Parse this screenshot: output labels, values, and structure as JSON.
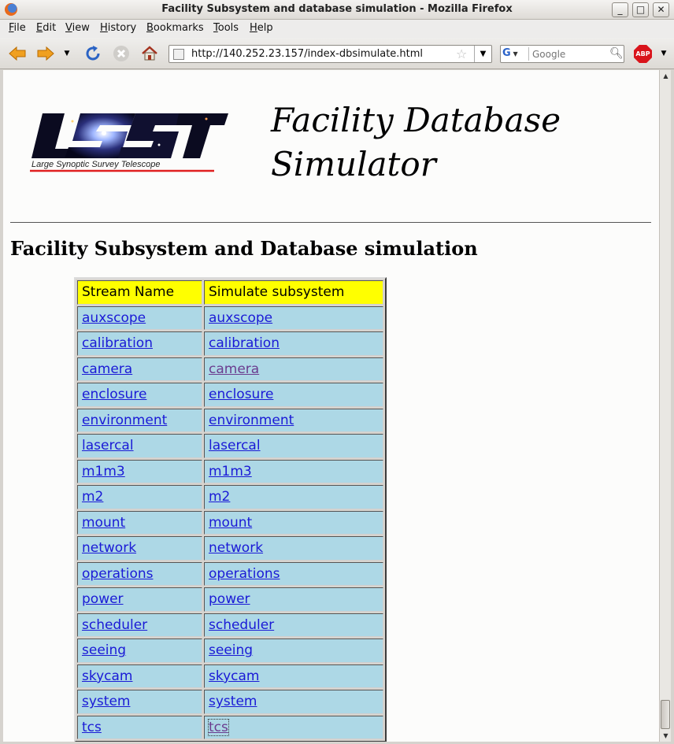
{
  "window": {
    "title": "Facility Subsystem and database simulation - Mozilla Firefox",
    "buttons": {
      "minimize": "_",
      "maximize": "□",
      "close": "✕"
    }
  },
  "menu": [
    {
      "label": "File"
    },
    {
      "label": "Edit"
    },
    {
      "label": "View"
    },
    {
      "label": "History"
    },
    {
      "label": "Bookmarks"
    },
    {
      "label": "Tools"
    },
    {
      "label": "Help"
    }
  ],
  "toolbar": {
    "url": "http://140.252.23.157/index-dbsimulate.html",
    "search_placeholder": "Google",
    "search_engine": "G",
    "adblock": "ABP"
  },
  "page": {
    "logo_text": "Large Synoptic Survey Telescope",
    "logo_letters": "LSST",
    "title": "Facility Database Simulator",
    "heading": "Facility Subsystem and Database simulation",
    "table": {
      "headers": [
        "Stream Name",
        "Simulate subsystem"
      ],
      "rows": [
        [
          "auxscope",
          "auxscope"
        ],
        [
          "calibration",
          "calibration"
        ],
        [
          "camera",
          "camera"
        ],
        [
          "enclosure",
          "enclosure"
        ],
        [
          "environment",
          "environment"
        ],
        [
          "lasercal",
          "lasercal"
        ],
        [
          "m1m3",
          "m1m3"
        ],
        [
          "m2",
          "m2"
        ],
        [
          "mount",
          "mount"
        ],
        [
          "network",
          "network"
        ],
        [
          "operations",
          "operations"
        ],
        [
          "power",
          "power"
        ],
        [
          "scheduler",
          "scheduler"
        ],
        [
          "seeing",
          "seeing"
        ],
        [
          "skycam",
          "skycam"
        ],
        [
          "system",
          "system"
        ],
        [
          "tcs",
          "tcs"
        ]
      ]
    }
  },
  "colors": {
    "header_cell": "#ffff00",
    "cell": "#add8e6",
    "link": "#1a1ad6",
    "visited_link": "#6b3c8f"
  }
}
